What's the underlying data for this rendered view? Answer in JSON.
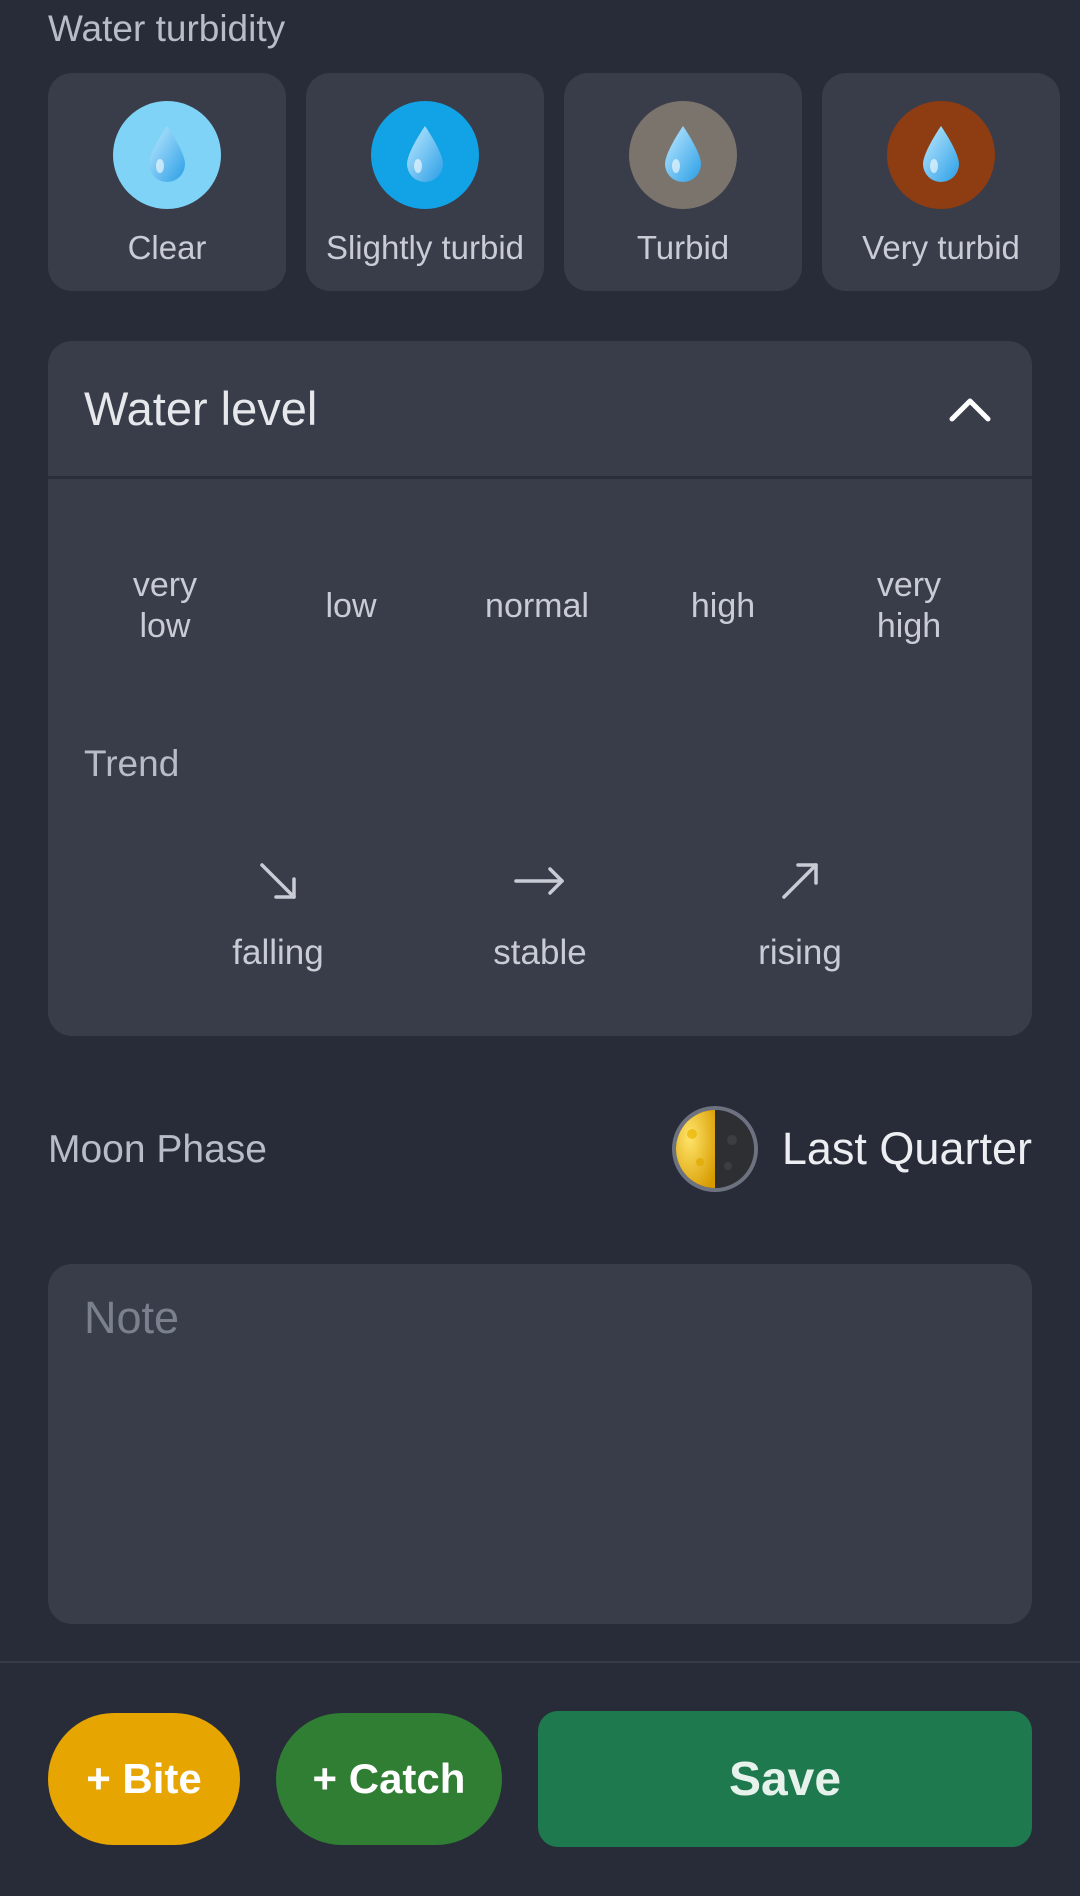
{
  "turbidity": {
    "label": "Water turbidity",
    "options": [
      {
        "label": "Clear",
        "color": "#7fd3f7",
        "icon": "water-drop-icon"
      },
      {
        "label": "Slightly turbid",
        "color": "#12a2e6",
        "icon": "water-drop-icon"
      },
      {
        "label": "Turbid",
        "color": "#7b746d",
        "icon": "water-drop-icon"
      },
      {
        "label": "Very turbid",
        "color": "#8e3d12",
        "icon": "water-drop-icon"
      }
    ]
  },
  "water_level": {
    "title": "Water level",
    "expanded": true,
    "levels": [
      "very\nlow",
      "low",
      "normal",
      "high",
      "very\nhigh"
    ],
    "trend_label": "Trend",
    "trends": [
      {
        "label": "falling",
        "icon": "arrow-down-right-icon"
      },
      {
        "label": "stable",
        "icon": "arrow-right-icon"
      },
      {
        "label": "rising",
        "icon": "arrow-up-right-icon"
      }
    ]
  },
  "moon": {
    "label": "Moon Phase",
    "value": "Last Quarter",
    "icon": "last-quarter-moon-icon"
  },
  "note": {
    "placeholder": "Note",
    "value": ""
  },
  "actions": {
    "bite_label": "+ Bite",
    "catch_label": "+ Catch",
    "save_label": "Save",
    "colors": {
      "bite": "#e6a500",
      "catch": "#2f7e33",
      "save": "#1e7a4e"
    }
  }
}
